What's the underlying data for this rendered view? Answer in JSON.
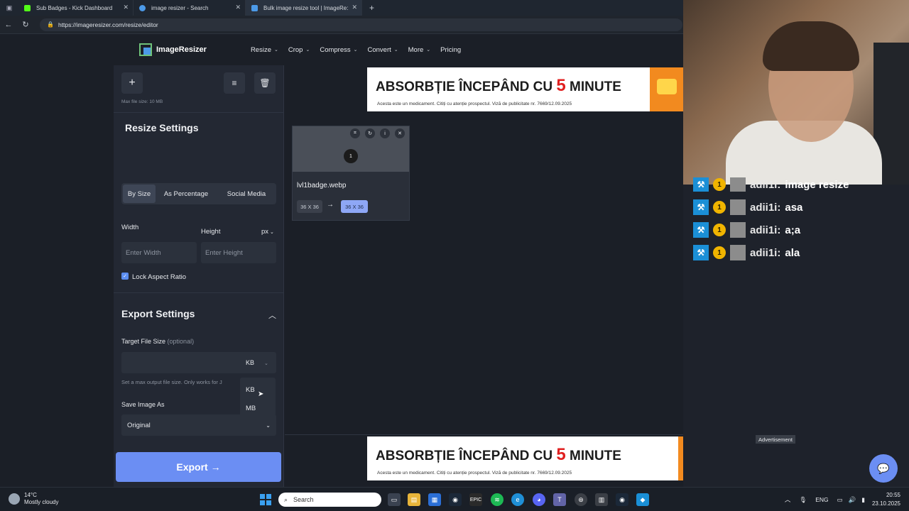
{
  "browser": {
    "tabs": [
      {
        "title": "Sub Badges - Kick Dashboard",
        "favicon_color": "#53fc18"
      },
      {
        "title": "image resizer - Search",
        "favicon_color": "#4c9ae8"
      },
      {
        "title": "Bulk image resize tool | ImageRe:",
        "favicon_color": "#4c9ae8"
      }
    ],
    "url": "https://imageresizer.com/resize/editor"
  },
  "site": {
    "logo": "ImageResizer",
    "menu": [
      {
        "label": "Resize"
      },
      {
        "label": "Crop"
      },
      {
        "label": "Compress"
      },
      {
        "label": "Convert"
      },
      {
        "label": "More"
      },
      {
        "label": "Pricing"
      }
    ]
  },
  "sidebar": {
    "max_file_size": "Max file size: 10 MB",
    "resize_title": "Resize Settings",
    "tabs": [
      "By Size",
      "As Percentage",
      "Social Media"
    ],
    "width_label": "Width",
    "height_label": "Height",
    "unit": "px",
    "width_placeholder": "Enter Width",
    "height_placeholder": "Enter Height",
    "lock_label": "Lock Aspect Ratio",
    "export_title": "Export Settings",
    "target_label": "Target File Size",
    "target_optional": "(optional)",
    "size_unit": "KB",
    "dropdown_options": [
      "KB",
      "MB"
    ],
    "hint": "Set a max output file size. Only works for J",
    "save_as_label": "Save Image As",
    "save_as_value": "Original",
    "export_button": "Export →"
  },
  "ad": {
    "headline_a": "ABSORBȚIE ÎNCEPÂND CU ",
    "headline_num": "5",
    "headline_b": " MINUTE",
    "subline": "Acesta este un medicament. Citiți cu atenție prospectul. Viză de publicitate nr. 7669/12.09.2025",
    "label": "Advertisement"
  },
  "card": {
    "filename": "lvl1badge.webp",
    "thumb_text": "1",
    "from_dim": "36 X 36",
    "to_dim": "36 X 36"
  },
  "chat": [
    {
      "user": "adii1i:",
      "msg": "image resize"
    },
    {
      "user": "adii1i:",
      "msg": "asa"
    },
    {
      "user": "adii1i:",
      "msg": "a;a"
    },
    {
      "user": "adii1i:",
      "msg": "ala"
    }
  ],
  "taskbar": {
    "temp": "14°C",
    "weather": "Mostly cloudy",
    "search": "Search",
    "lang": "ENG",
    "time": "20:55",
    "date": "23.10.2025"
  }
}
